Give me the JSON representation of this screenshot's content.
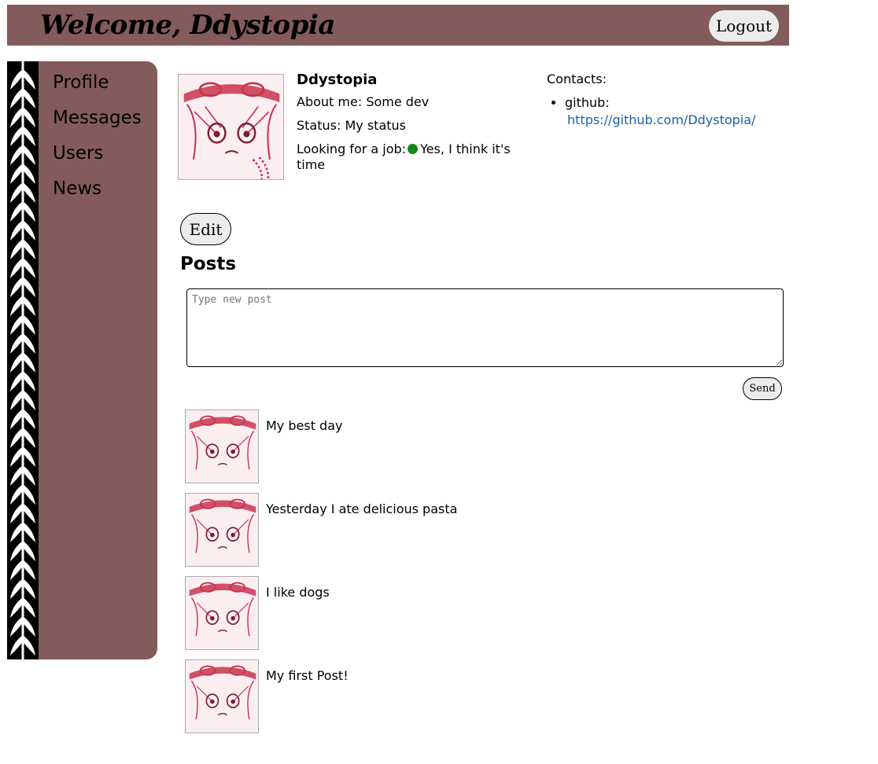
{
  "header": {
    "title": "Welcome, Ddystopia",
    "logout_label": "Logout"
  },
  "sidebar": {
    "items": [
      {
        "label": "Profile"
      },
      {
        "label": "Messages"
      },
      {
        "label": "Users"
      },
      {
        "label": "News"
      }
    ]
  },
  "profile": {
    "name": "Ddystopia",
    "about_label": "About me:",
    "about_value": "Some dev",
    "status_label": "Status:",
    "status_value": "My status",
    "job_label": "Looking for a job:",
    "job_value": "Yes, I think it's time",
    "contacts_label": "Contacts:",
    "contacts": [
      {
        "name": "github:",
        "url": "https://github.com/Ddystopia/"
      }
    ],
    "edit_label": "Edit"
  },
  "posts": {
    "title": "Posts",
    "input_placeholder": "Type new post",
    "send_label": "Send",
    "items": [
      {
        "text": "My best day"
      },
      {
        "text": "Yesterday I ate delicious pasta"
      },
      {
        "text": "I like dogs"
      },
      {
        "text": "My first Post!"
      }
    ]
  },
  "colors": {
    "brand": "#835b5b",
    "job_status": "#138a13",
    "link": "#1a5fa8",
    "avatar_accent": "#c8344f"
  }
}
